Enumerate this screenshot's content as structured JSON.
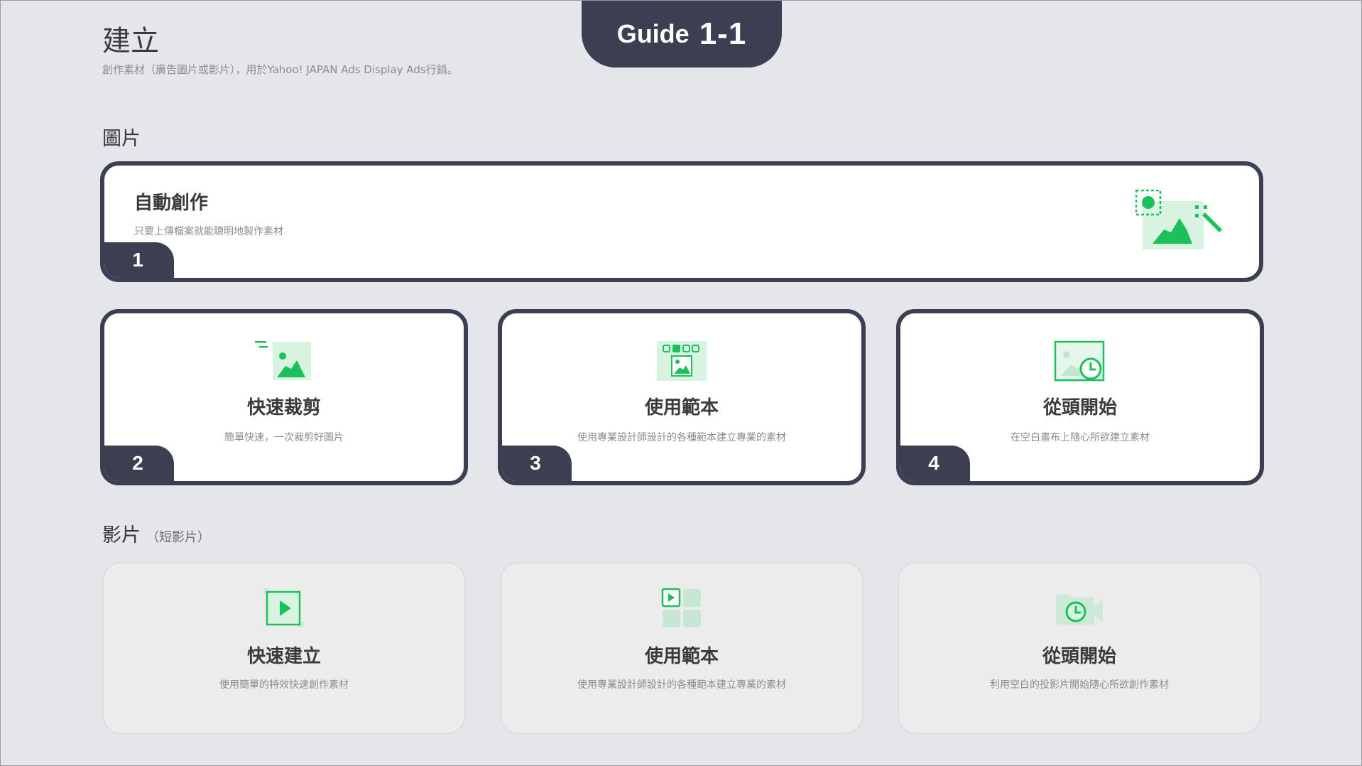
{
  "guide": {
    "word": "Guide",
    "number": "1-1"
  },
  "header": {
    "title": "建立",
    "subtitle": "創作素材（廣告圖片或影片），用於Yahoo! JAPAN Ads Display Ads行銷。"
  },
  "image_section": {
    "title": "圖片",
    "auto": {
      "title": "自動創作",
      "desc": "只要上傳檔案就能聰明地製作素材",
      "badge": "1",
      "icon": "auto-create-icon"
    },
    "cards": [
      {
        "title": "快速裁剪",
        "desc": "簡單快速，一次裁剪好圖片",
        "badge": "2",
        "icon": "quick-crop-icon"
      },
      {
        "title": "使用範本",
        "desc": "使用專業設計師設計的各種範本建立專業的素材",
        "badge": "3",
        "icon": "template-icon"
      },
      {
        "title": "從頭開始",
        "desc": "在空白畫布上隨心所欲建立素材",
        "badge": "4",
        "icon": "blank-canvas-icon"
      }
    ]
  },
  "video_section": {
    "title": "影片",
    "title_note": "（短影片）",
    "cards": [
      {
        "title": "快速建立",
        "desc": "使用簡單的特效快速創作素材",
        "icon": "video-quick-icon"
      },
      {
        "title": "使用範本",
        "desc": "使用專業設計師設計的各種範本建立專業的素材",
        "icon": "video-template-icon"
      },
      {
        "title": "從頭開始",
        "desc": "利用空白的投影片開始隨心所欲創作素材",
        "icon": "video-blank-icon"
      }
    ]
  },
  "colors": {
    "accent_green": "#1cc05a",
    "dark": "#3c3f52",
    "background": "#e4e6ea"
  }
}
